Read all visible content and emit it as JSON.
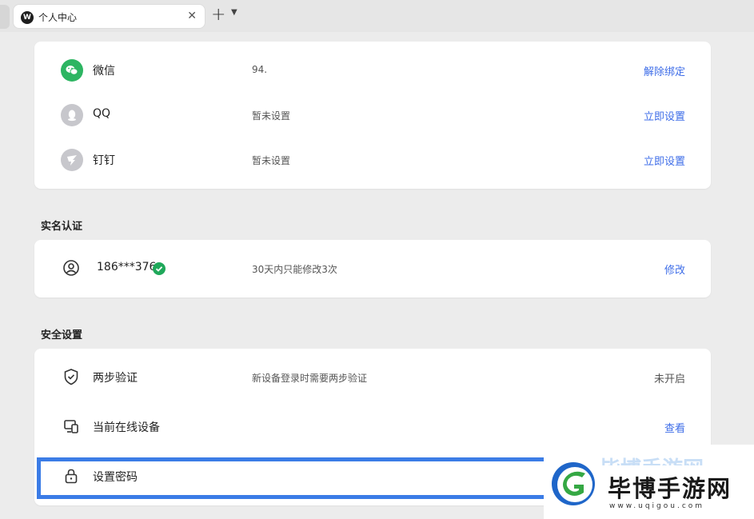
{
  "tab": {
    "title": "个人中心",
    "logo": "W"
  },
  "accounts": [
    {
      "name": "微信",
      "value": "94.",
      "action": "解除绑定",
      "icon": "wechat-icon",
      "color": "#2db562"
    },
    {
      "name": "QQ",
      "value": "暂未设置",
      "action": "立即设置",
      "icon": "qq-icon",
      "color": "#c7c7cc"
    },
    {
      "name": "钉钉",
      "value": "暂未设置",
      "action": "立即设置",
      "icon": "dingtalk-icon",
      "color": "#c7c7cc"
    }
  ],
  "realname": {
    "title": "实名认证",
    "phone": "186***376",
    "note": "30天内只能修改3次",
    "action": "修改"
  },
  "security": {
    "title": "安全设置",
    "rows": [
      {
        "name": "两步验证",
        "desc": "新设备登录时需要两步验证",
        "action": "未开启"
      },
      {
        "name": "当前在线设备",
        "desc": "",
        "action": "查看"
      },
      {
        "name": "设置密码",
        "desc": "",
        "action": ""
      }
    ]
  },
  "watermark": {
    "brand": "毕博手游网",
    "url": "www.uqigou.com"
  },
  "colors": {
    "accent": "#3e6de8",
    "highlight": "#3b7ce6",
    "success": "#1fa85a"
  }
}
